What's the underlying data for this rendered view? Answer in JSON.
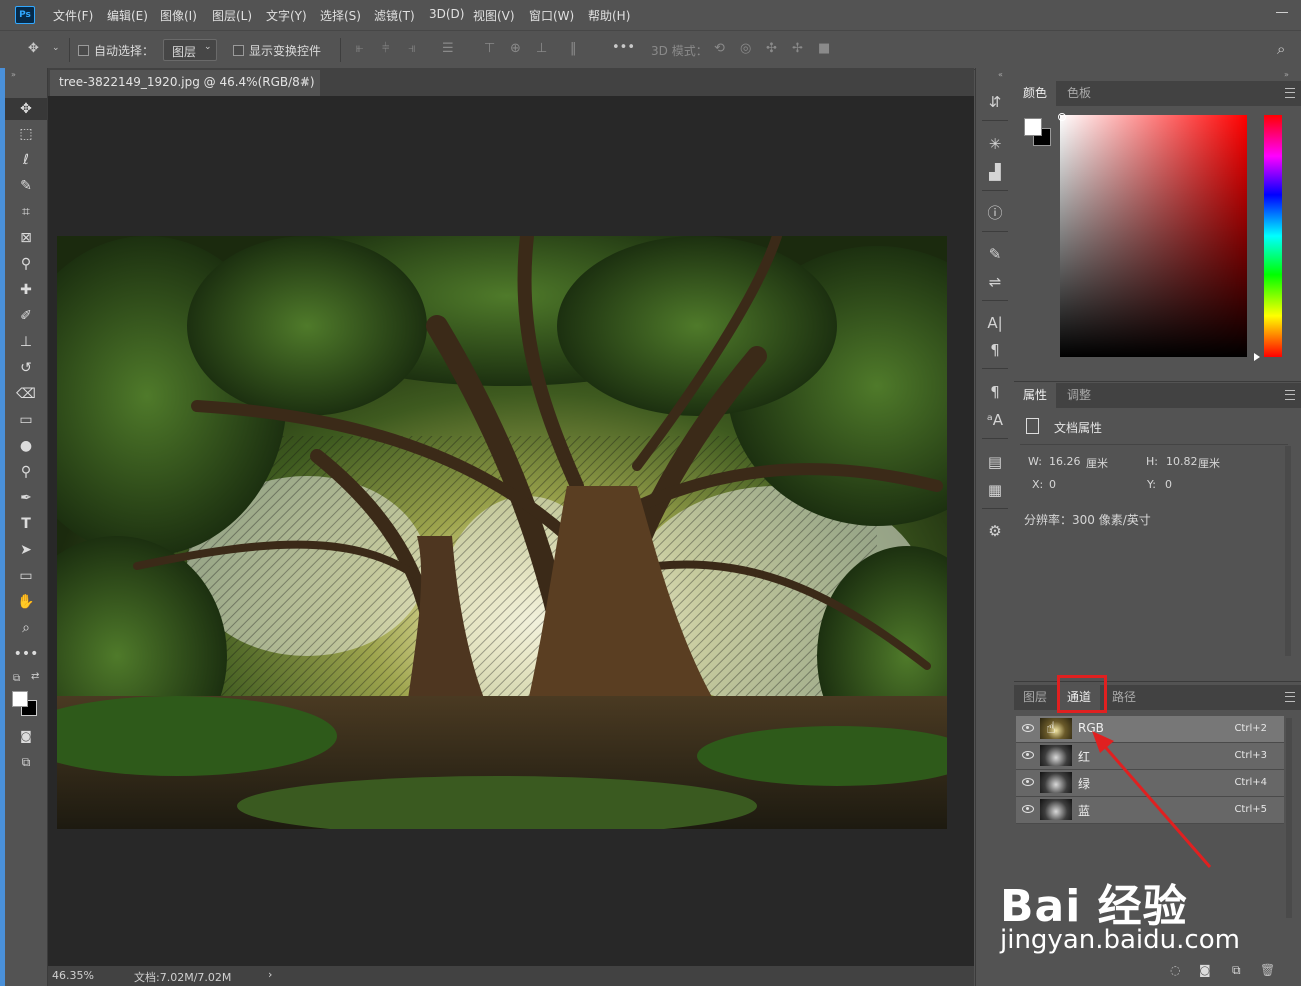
{
  "app": {
    "logo": "Ps"
  },
  "menu": [
    "文件(F)",
    "编辑(E)",
    "图像(I)",
    "图层(L)",
    "文字(Y)",
    "选择(S)",
    "滤镜(T)",
    "3D(D)",
    "视图(V)",
    "窗口(W)",
    "帮助(H)"
  ],
  "options": {
    "auto_select_label": "自动选择：",
    "auto_select_value": "图层",
    "show_transform_label": "显示变换控件",
    "more": "•••",
    "mode_3d_label": "3D 模式："
  },
  "document": {
    "tab_title": "tree-3822149_1920.jpg @ 46.4%(RGB/8#) *",
    "tab_close": "×",
    "zoom": "46.35%",
    "doc_size": "文档:7.02M/7.02M",
    "status_arrow": "›"
  },
  "panels": {
    "color_tabs": [
      "颜色",
      "色板"
    ],
    "props_tabs": [
      "属性",
      "调整"
    ],
    "props_section": "文档属性",
    "width_label": "W:",
    "width_value": "16.26",
    "width_unit": "厘米",
    "height_label": "H:",
    "height_value": "10.82",
    "height_unit": "厘米",
    "x_label": "X:",
    "x_value": "0",
    "y_label": "Y:",
    "y_value": "0",
    "resolution": "分辨率：300 像素/英寸",
    "layer_tabs": [
      "图层",
      "通道",
      "路径"
    ],
    "channels": [
      {
        "name": "RGB",
        "shortcut": "Ctrl+2"
      },
      {
        "name": "红",
        "shortcut": "Ctrl+3"
      },
      {
        "name": "绿",
        "shortcut": "Ctrl+4"
      },
      {
        "name": "蓝",
        "shortcut": "Ctrl+5"
      }
    ]
  },
  "watermark": {
    "line1": "Bai 经验",
    "line2": "jingyan.baidu.com"
  },
  "colors": {
    "highlight": "#e02020",
    "ui_bg": "#535353",
    "canvas_bg": "#282828"
  },
  "icons": [
    "move-icon",
    "marquee-icon",
    "lasso-icon",
    "quick-select-icon",
    "crop-icon",
    "frame-icon",
    "eyedropper-icon",
    "healing-icon",
    "brush-icon",
    "stamp-icon",
    "history-brush-icon",
    "eraser-icon",
    "gradient-icon",
    "blur-icon",
    "dodge-icon",
    "pen-icon",
    "type-icon",
    "path-select-icon",
    "rectangle-icon",
    "hand-icon",
    "zoom-icon",
    "more-tools-icon"
  ]
}
